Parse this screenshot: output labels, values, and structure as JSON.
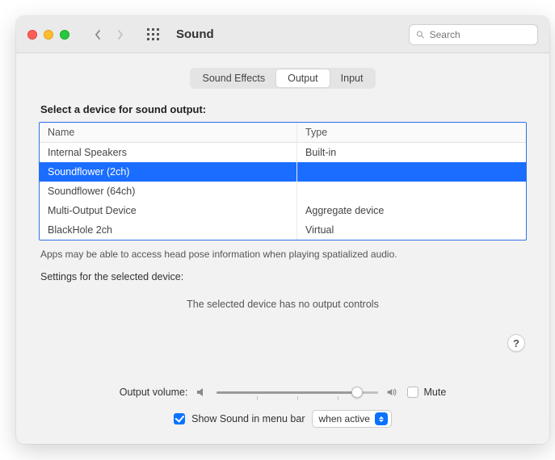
{
  "window": {
    "title": "Sound"
  },
  "search": {
    "placeholder": "Search"
  },
  "tabs": [
    {
      "label": "Sound Effects",
      "active": false
    },
    {
      "label": "Output",
      "active": true
    },
    {
      "label": "Input",
      "active": false
    }
  ],
  "output": {
    "heading": "Select a device for sound output:",
    "columns": {
      "name": "Name",
      "type": "Type"
    },
    "devices": [
      {
        "name": "Internal Speakers",
        "type": "Built-in",
        "selected": false
      },
      {
        "name": "Soundflower (2ch)",
        "type": "",
        "selected": true
      },
      {
        "name": "Soundflower (64ch)",
        "type": "",
        "selected": false
      },
      {
        "name": "Multi-Output Device",
        "type": "Aggregate device",
        "selected": false
      },
      {
        "name": "BlackHole 2ch",
        "type": "Virtual",
        "selected": false
      }
    ],
    "note": "Apps may be able to access head pose information when playing spatialized audio.",
    "settings_label": "Settings for the selected device:",
    "no_controls": "The selected device has no output controls",
    "help_label": "?"
  },
  "volume": {
    "label": "Output volume:",
    "value": 0.87,
    "mute_label": "Mute",
    "muted": false
  },
  "menubar": {
    "checked": true,
    "label": "Show Sound in menu bar",
    "mode": "when active"
  }
}
